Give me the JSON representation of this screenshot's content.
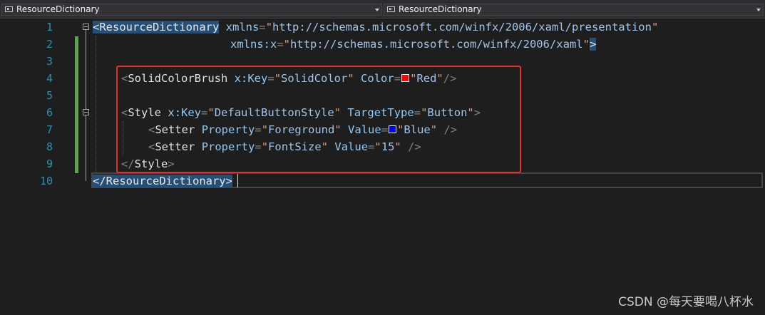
{
  "nav": {
    "left_combo": "ResourceDictionary",
    "right_combo": "ResourceDictionary"
  },
  "colors": {
    "red_swatch": "#ff0000",
    "blue_swatch": "#0000ff",
    "highlight_box": "#e3302c",
    "change_bar": "#57a64a"
  },
  "lines": [
    {
      "n": "1"
    },
    {
      "n": "2"
    },
    {
      "n": "3"
    },
    {
      "n": "4"
    },
    {
      "n": "5"
    },
    {
      "n": "6"
    },
    {
      "n": "7"
    },
    {
      "n": "8"
    },
    {
      "n": "9"
    },
    {
      "n": "10"
    }
  ],
  "code": {
    "l1": {
      "tag": "ResourceDictionary",
      "attr": "xmlns",
      "val": "http://schemas.microsoft.com/winfx/2006/xaml/presentation"
    },
    "l2": {
      "attr": "xmlns:x",
      "val": "http://schemas.microsoft.com/winfx/2006/xaml"
    },
    "l4": {
      "tag": "SolidColorBrush",
      "a1": "x:Key",
      "v1": "SolidColor",
      "a2": "Color",
      "v2": "Red"
    },
    "l6": {
      "tag": "Style",
      "a1": "x:Key",
      "v1": "DefaultButtonStyle",
      "a2": "TargetType",
      "v2": "Button"
    },
    "l7": {
      "tag": "Setter",
      "a1": "Property",
      "v1": "Foreground",
      "a2": "Value",
      "v2": "Blue"
    },
    "l8": {
      "tag": "Setter",
      "a1": "Property",
      "v1": "FontSize",
      "a2": "Value",
      "v2": "15"
    },
    "l9": {
      "tag": "Style"
    },
    "l10": {
      "tag": "ResourceDictionary"
    }
  },
  "watermark": "CSDN @每天要喝八杯水"
}
